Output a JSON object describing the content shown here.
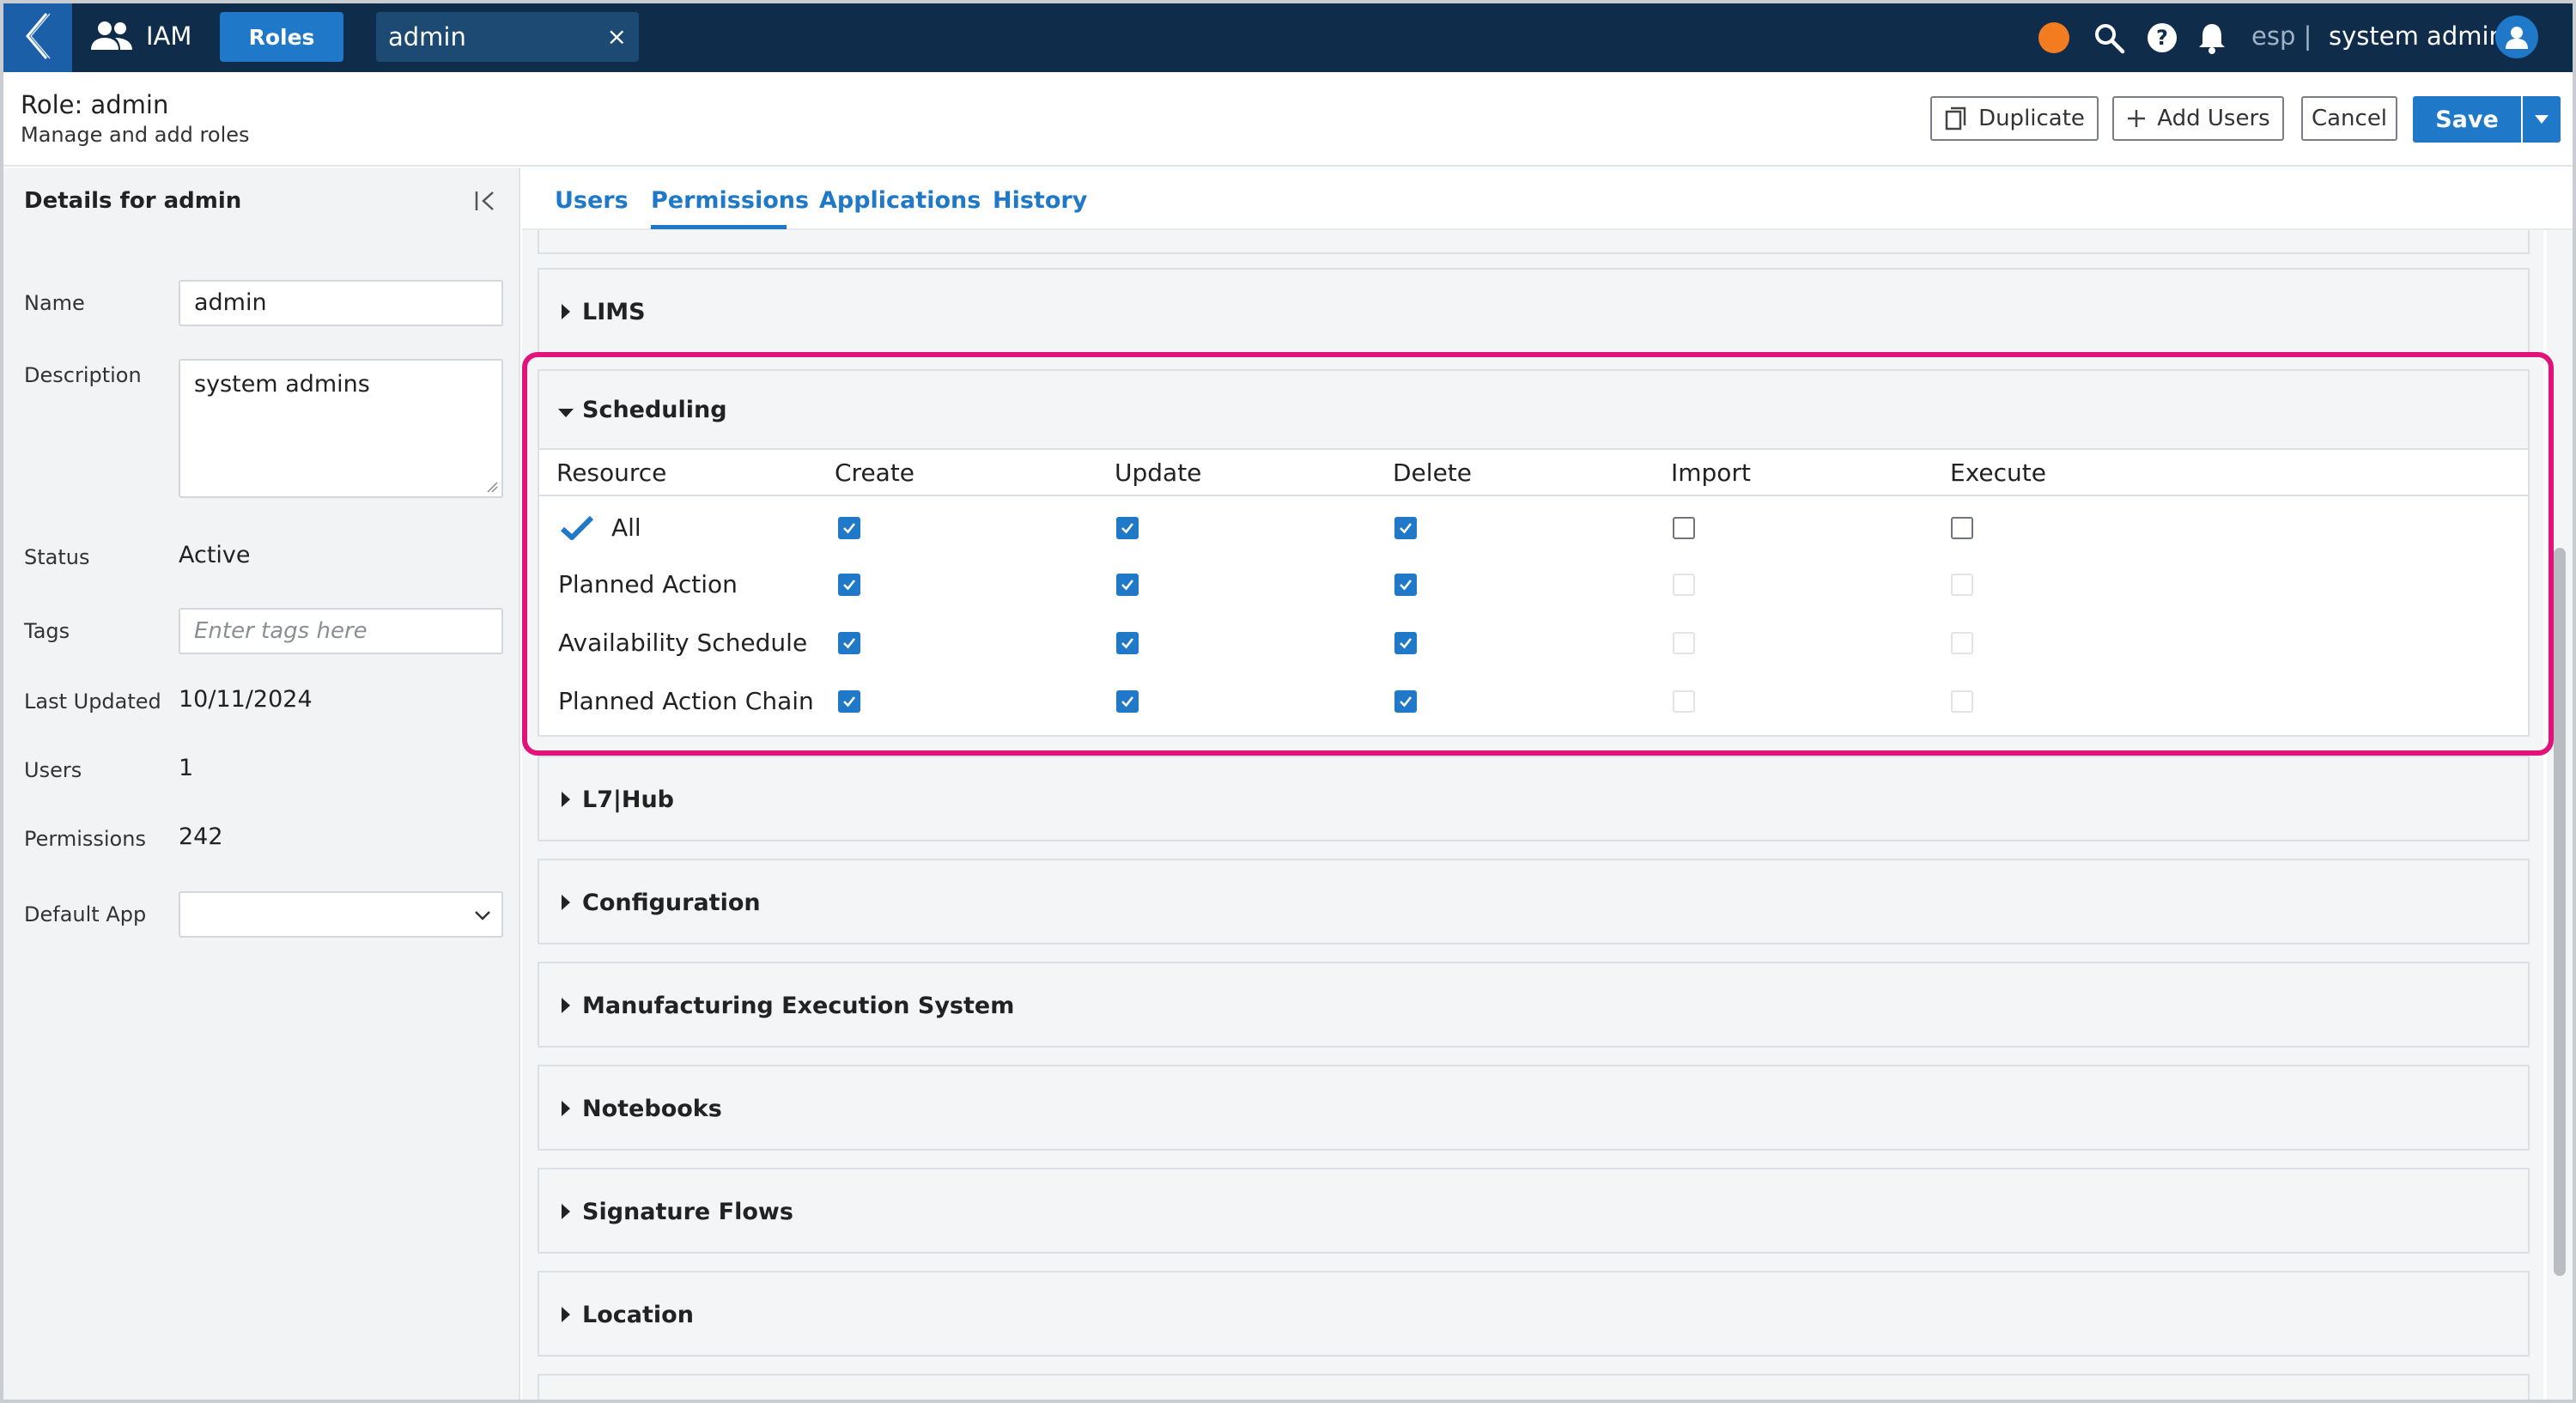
{
  "topbar": {
    "app_name": "IAM",
    "breadcrumb_roles": "Roles",
    "breadcrumb_admin": "admin",
    "close_glyph": "×",
    "env": "esp |",
    "user": "system admin",
    "status_color": "#f47c20"
  },
  "header": {
    "role_label": "Role:",
    "role_name": "admin",
    "subtitle": "Manage and add roles",
    "duplicate": "Duplicate",
    "add_users": "Add Users",
    "cancel": "Cancel",
    "save": "Save"
  },
  "details": {
    "title": "Details for admin",
    "fields": {
      "name_label": "Name",
      "name_value": "admin",
      "description_label": "Description",
      "description_value": "system admins",
      "status_label": "Status",
      "status_value": "Active",
      "tags_label": "Tags",
      "tags_placeholder": "Enter tags here",
      "last_updated_label": "Last Updated",
      "last_updated_value": "10/11/2024",
      "users_label": "Users",
      "users_value": "1",
      "permissions_label": "Permissions",
      "permissions_value": "242",
      "default_app_label": "Default App",
      "default_app_value": ""
    }
  },
  "tabs": [
    "Users",
    "Permissions",
    "Applications",
    "History"
  ],
  "active_tab": "Permissions",
  "sections": {
    "lims": "LIMS",
    "scheduling": "Scheduling",
    "l7hub": "L7|Hub",
    "configuration": "Configuration",
    "mes": "Manufacturing Execution System",
    "notebooks": "Notebooks",
    "signature_flows": "Signature Flows",
    "location": "Location"
  },
  "scheduling_table": {
    "columns": [
      "Resource",
      "Create",
      "Update",
      "Delete",
      "Import",
      "Execute"
    ],
    "rows": [
      {
        "resource": "All",
        "create": "checked",
        "update": "checked",
        "delete": "checked",
        "import": "unchecked",
        "execute": "unchecked"
      },
      {
        "resource": "Planned Action",
        "create": "checked",
        "update": "checked",
        "delete": "checked",
        "import": "disabled",
        "execute": "disabled"
      },
      {
        "resource": "Availability Schedule",
        "create": "checked",
        "update": "checked",
        "delete": "checked",
        "import": "disabled",
        "execute": "disabled"
      },
      {
        "resource": "Planned Action Chain",
        "create": "checked",
        "update": "checked",
        "delete": "checked",
        "import": "disabled",
        "execute": "disabled"
      }
    ]
  },
  "colors": {
    "topbar": "#0f2d4a",
    "accent": "#1f78c8",
    "highlight": "#e0127c"
  }
}
